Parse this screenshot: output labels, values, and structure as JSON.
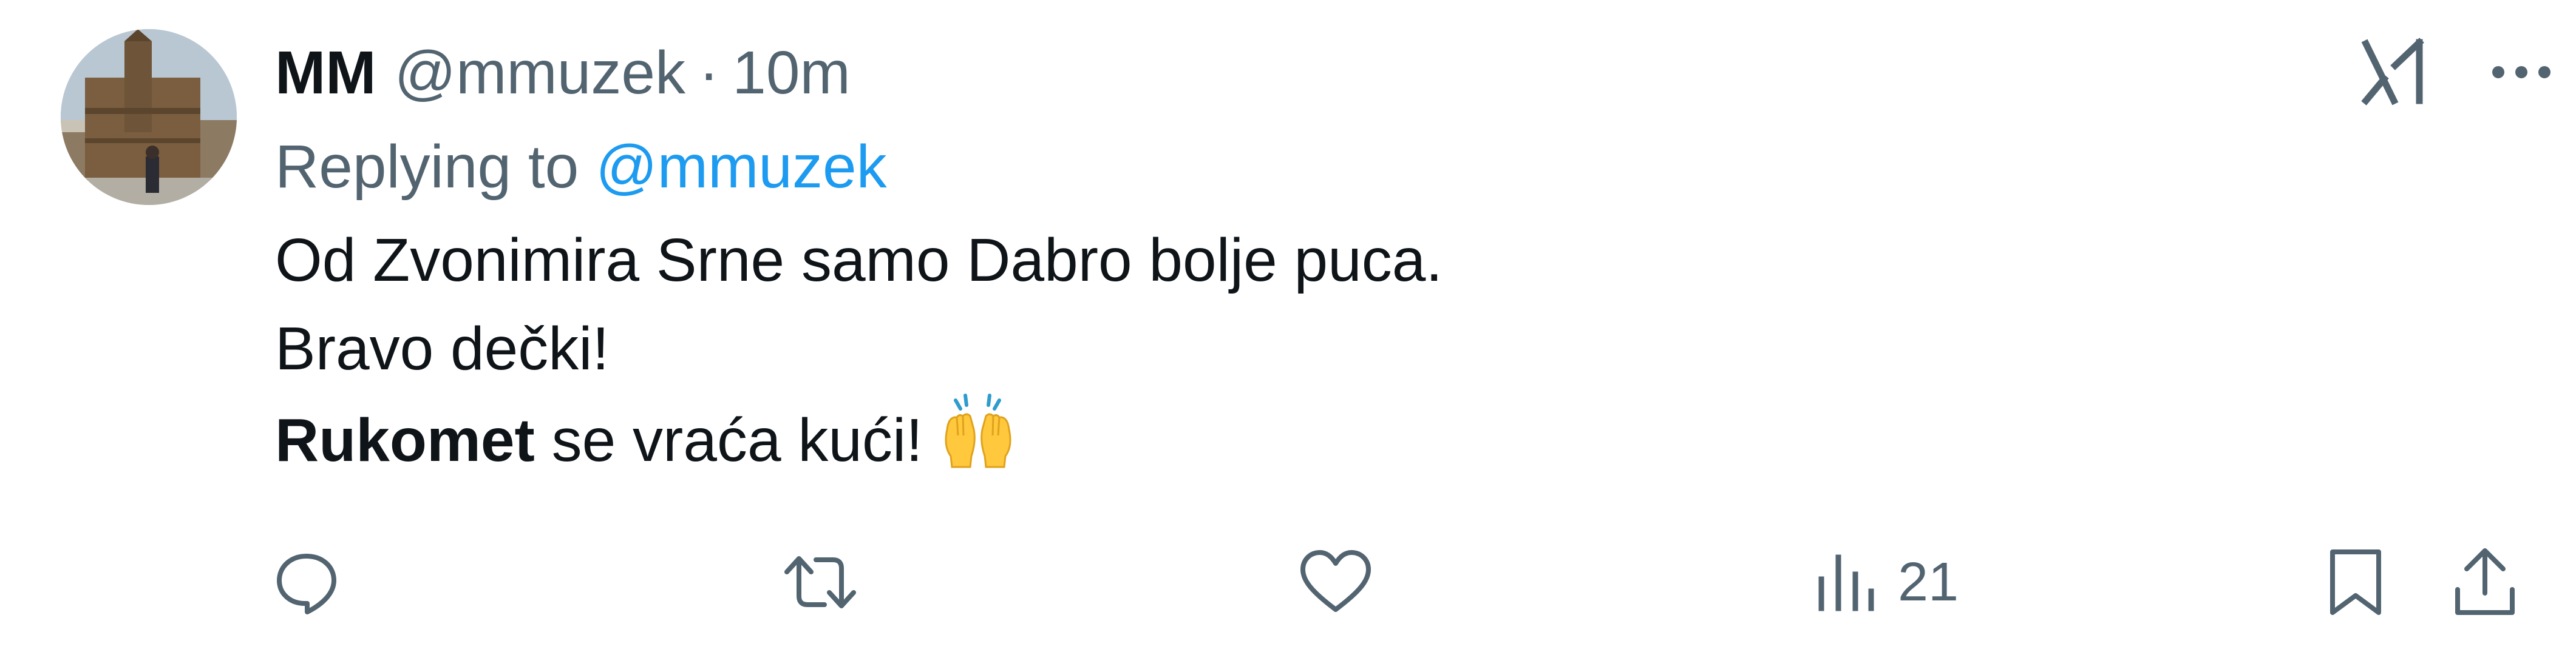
{
  "tweet": {
    "display_name": "MM",
    "handle": "@mmuzek",
    "separator": "·",
    "time": "10m",
    "replying_prefix": "Replying to",
    "replying_to": "@mmuzek",
    "body": {
      "line1": "Od Zvonimira Srne samo Dabro bolje puca.",
      "line2": "Bravo dečki!",
      "line3_bold": "Rukomet",
      "line3_rest": " se vraća kući!"
    },
    "emoji": "raising-hands-emoji"
  },
  "actions": {
    "views_count": "21"
  },
  "colors": {
    "text": "#0f1419",
    "secondary": "#536471",
    "accent": "#1d9bf0",
    "background": "#ffffff"
  },
  "icons": [
    "grok-icon",
    "more-icon",
    "reply-icon",
    "repost-icon",
    "like-icon",
    "views-icon",
    "bookmark-icon",
    "share-icon"
  ]
}
